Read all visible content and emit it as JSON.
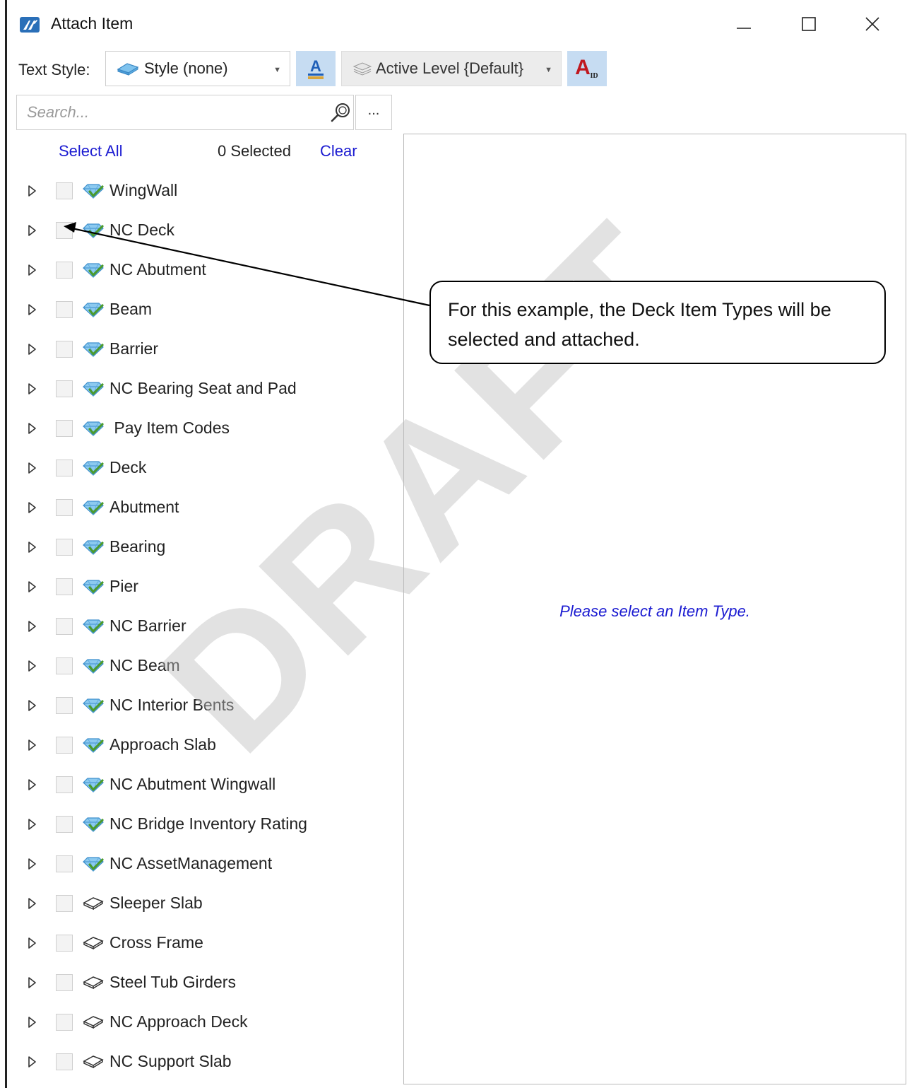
{
  "window": {
    "title": "Attach Item",
    "controls": [
      "minimize",
      "maximize",
      "close"
    ]
  },
  "toolbar": {
    "text_style_label": "Text Style:",
    "text_style_value": "Style (none)",
    "level_value": "Active Level {Default}",
    "text_color_icon": "text-color-a-icon",
    "text_id_icon": "text-id-icon"
  },
  "search": {
    "placeholder": "Search...",
    "more_label": "..."
  },
  "selection": {
    "select_all": "Select All",
    "selected_count": "0  Selected",
    "clear": "Clear"
  },
  "item_types": [
    {
      "label": "WingWall",
      "icon": "gem-check"
    },
    {
      "label": "NC Deck",
      "icon": "gem-check"
    },
    {
      "label": "NC Abutment",
      "icon": "gem-check"
    },
    {
      "label": "Beam",
      "icon": "gem-check"
    },
    {
      "label": "Barrier",
      "icon": "gem-check"
    },
    {
      "label": "NC Bearing Seat and Pad",
      "icon": "gem-check"
    },
    {
      "label": " Pay Item Codes",
      "icon": "gem-check"
    },
    {
      "label": "Deck",
      "icon": "gem-check"
    },
    {
      "label": "Abutment",
      "icon": "gem-check"
    },
    {
      "label": "Bearing",
      "icon": "gem-check"
    },
    {
      "label": "Pier",
      "icon": "gem-check"
    },
    {
      "label": "NC Barrier",
      "icon": "gem-check"
    },
    {
      "label": "NC Beam",
      "icon": "gem-check"
    },
    {
      "label": "NC Interior Bents",
      "icon": "gem-check"
    },
    {
      "label": "Approach Slab",
      "icon": "gem-check"
    },
    {
      "label": "NC Abutment Wingwall",
      "icon": "gem-check"
    },
    {
      "label": "NC Bridge Inventory Rating",
      "icon": "gem-check"
    },
    {
      "label": "NC AssetManagement",
      "icon": "gem-check"
    },
    {
      "label": "Sleeper Slab",
      "icon": "gem-outline"
    },
    {
      "label": "Cross Frame",
      "icon": "gem-outline"
    },
    {
      "label": "Steel Tub Girders",
      "icon": "gem-outline"
    },
    {
      "label": "NC Approach Deck",
      "icon": "gem-outline"
    },
    {
      "label": "NC Support Slab",
      "icon": "gem-outline"
    }
  ],
  "details": {
    "empty_message": "Please select an Item Type."
  },
  "annotation": {
    "callout_text": "For this example, the Deck Item Types will be selected and attached.",
    "watermark": "DRAFT"
  },
  "colors": {
    "link": "#1b1bd1",
    "tool_button_bg": "#c6dcf2",
    "gem_blue": "#6fb6e6",
    "gem_check": "#5aa83c"
  }
}
